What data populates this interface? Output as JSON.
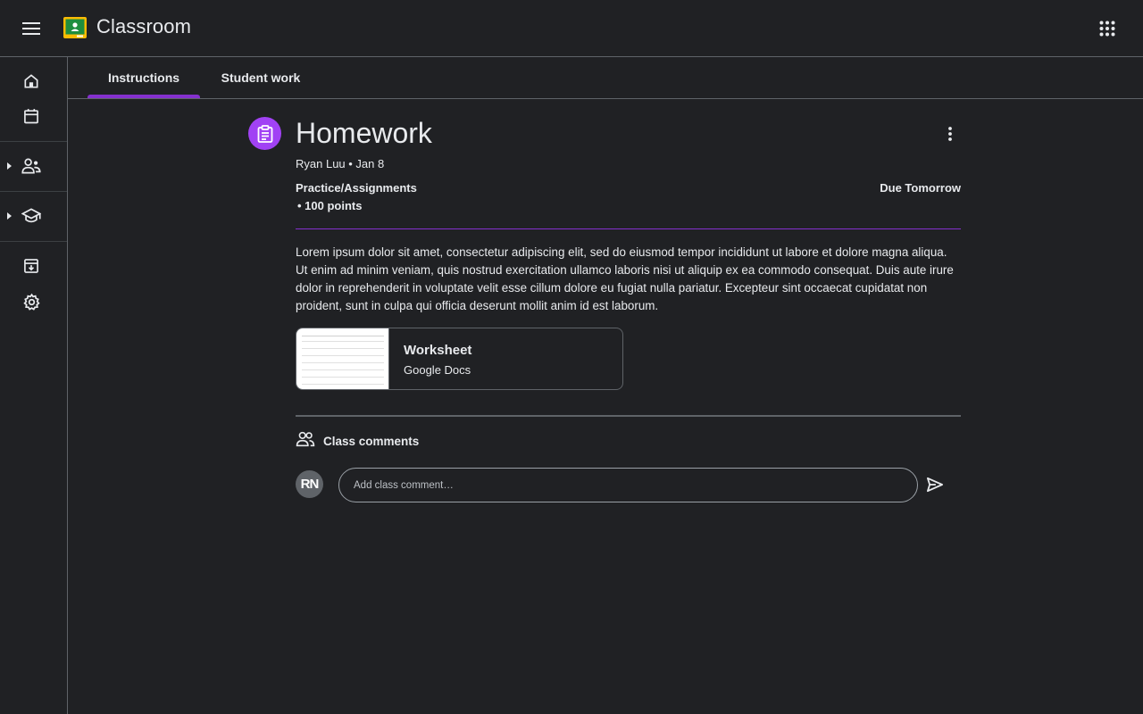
{
  "header": {
    "app_title": "Classroom",
    "menu_icon": "hamburger-menu-icon",
    "apps_icon": "apps-grid-icon",
    "logo_icon": "classroom-logo-icon"
  },
  "rail": {
    "items": [
      {
        "name": "home",
        "icon": "home-icon"
      },
      {
        "name": "calendar",
        "icon": "calendar-icon"
      },
      {
        "name": "teaching",
        "icon": "people-icon"
      },
      {
        "name": "enrolled",
        "icon": "school-icon"
      },
      {
        "name": "archived",
        "icon": "archive-icon"
      },
      {
        "name": "settings",
        "icon": "settings-gear-icon"
      }
    ]
  },
  "tabs": [
    {
      "label": "Instructions",
      "selected": true
    },
    {
      "label": "Student work",
      "selected": false
    }
  ],
  "assignment": {
    "title": "Homework",
    "meta": "Ryan Luu • Jan 8",
    "category": "Practice/Assignments",
    "points": "• 100 points",
    "due": "Due Tomorrow",
    "description": "Lorem ipsum dolor sit amet, consectetur adipiscing elit, sed do eiusmod tempor incididunt ut labore et dolore magna aliqua. Ut enim ad minim veniam, quis nostrud exercitation ullamco laboris nisi ut aliquip ex ea commodo consequat. Duis aute irure dolor in reprehenderit in voluptate velit esse cillum dolore eu fugiat nulla pariatur. Excepteur sint occaecat cupidatat non proident, sunt in culpa qui officia deserunt mollit anim id est laborum.",
    "attachment": {
      "title": "Worksheet",
      "type": "Google Docs"
    }
  },
  "comments": {
    "label": "Class comments",
    "avatar_initials": "RN",
    "placeholder": "Add class comment…"
  },
  "colors": {
    "background": "#202124",
    "accent": "#8430ce",
    "assignment_icon_bg": "#a142f4",
    "divider": "#5f6368",
    "text": "#e8eaed"
  }
}
